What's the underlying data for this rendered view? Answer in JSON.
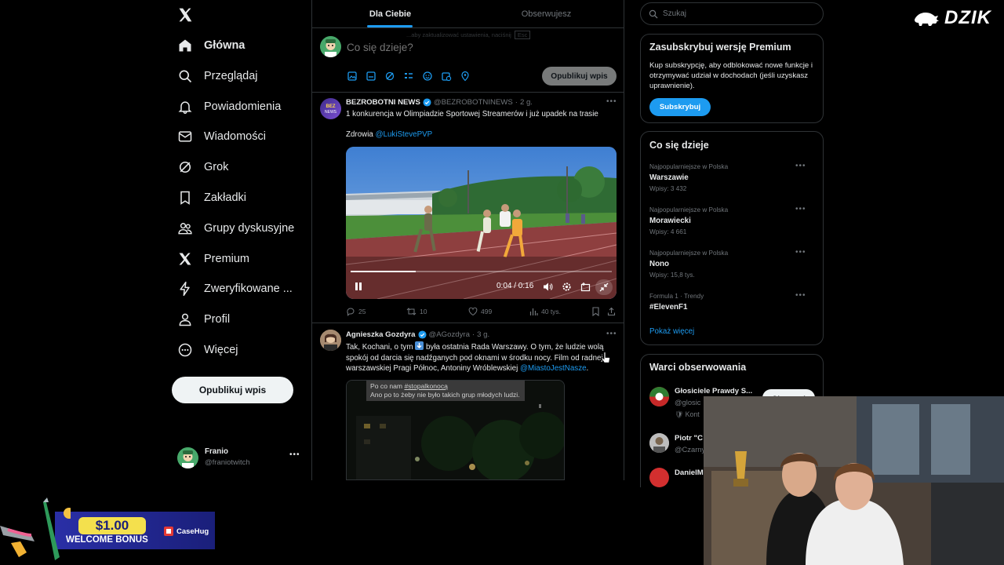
{
  "nav": {
    "items": [
      {
        "label": "Główna",
        "icon": "home-icon"
      },
      {
        "label": "Przeglądaj",
        "icon": "search-icon"
      },
      {
        "label": "Powiadomienia",
        "icon": "bell-icon"
      },
      {
        "label": "Wiadomości",
        "icon": "mail-icon"
      },
      {
        "label": "Grok",
        "icon": "grok-icon"
      },
      {
        "label": "Zakładki",
        "icon": "bookmark-icon"
      },
      {
        "label": "Grupy dyskusyjne",
        "icon": "people-icon"
      },
      {
        "label": "Premium",
        "icon": "x-logo-icon"
      },
      {
        "label": "Zweryfikowane ...",
        "icon": "lightning-icon"
      },
      {
        "label": "Profil",
        "icon": "person-icon"
      },
      {
        "label": "Więcej",
        "icon": "more-circle-icon"
      }
    ],
    "post_button": "Opublikuj wpis"
  },
  "account": {
    "name": "Franio",
    "handle": "@franiotwitch"
  },
  "tabs": {
    "for_you": "Dla Ciebie",
    "following": "Obserwujesz"
  },
  "composer": {
    "placeholder": "Co się dzieje?",
    "submit": "Opublikuj wpis",
    "ghost_hint": "...aby zaktualizować ustawienia, naciśnij",
    "ghost_key": "Esc"
  },
  "tweets": [
    {
      "author": "BEZROBOTNI NEWS",
      "handle": "@BEZROBOTNINEWS",
      "time": "2 g.",
      "text1": "1 konkurencja w Olimpiadzie Sportowej Streamerów i już upadek na trasie",
      "text2_prefix": "Zdrowia",
      "mention": "@LukiStevePVP",
      "video_time": "0:04 / 0:16",
      "video_progress": 0.25,
      "replies": "25",
      "reposts": "10",
      "likes": "499",
      "views": "40 tys."
    },
    {
      "author": "Agnieszka Gozdyra",
      "handle": "@AGozdyra",
      "time": "3 g.",
      "text_a": "Tak, Kochani, o tym",
      "text_b": "była ostatnia Rada Warszawy. O tym, że ludzie wolą spokój od darcia się nadźganych pod oknami w środku nocy. Film od radnej warszawskiej Pragi Północ, Antoniny Wróblewskiej",
      "mention": "@MiastoJestNasze",
      "overlay_prefix": "Po co nam",
      "overlay_hashtag": "#stopalkonocą",
      "overlay_rest": "Ano po to żeby nie było takich grup młodych ludzi."
    }
  ],
  "search": {
    "placeholder": "Szukaj"
  },
  "premium": {
    "title": "Zasubskrybuj wersję Premium",
    "body": "Kup subskrypcję, aby odblokować nowe funkcje i otrzymywać udział w dochodach (jeśli uzyskasz uprawnienie).",
    "button": "Subskrybuj"
  },
  "trends": {
    "title": "Co się dzieje",
    "items": [
      {
        "meta": "Najpopularniejsze w Polska",
        "name": "Warszawie",
        "count": "Wpisy: 3 432"
      },
      {
        "meta": "Najpopularniejsze w Polska",
        "name": "Morawiecki",
        "count": "Wpisy: 4 661"
      },
      {
        "meta": "Najpopularniejsze w Polska",
        "name": "Nono",
        "count": "Wpisy: 15,8 tys."
      },
      {
        "meta": "Formula 1 · Trendy",
        "name": "#ElevenF1",
        "count": ""
      }
    ],
    "show_more": "Pokaż więcej"
  },
  "who_to_follow": {
    "title": "Warci obserwowania",
    "items": [
      {
        "name": "Głosiciele Prawdy S...",
        "handle": "@glosic",
        "extra": "Kont",
        "button": "Obserwuj"
      },
      {
        "name": "Piotr \"C",
        "handle": "@Czarny"
      },
      {
        "name": "DanielM",
        "handle": ""
      }
    ]
  },
  "overlays": {
    "channel_logo": "DZIK",
    "bonus_amount": "$1.00",
    "bonus_text": "WELCOME BONUS",
    "bonus_brand": "CaseHug"
  },
  "colors": {
    "accent": "#1d9bf0",
    "bg": "#000000",
    "border": "#2f3336",
    "muted": "#71767b"
  }
}
